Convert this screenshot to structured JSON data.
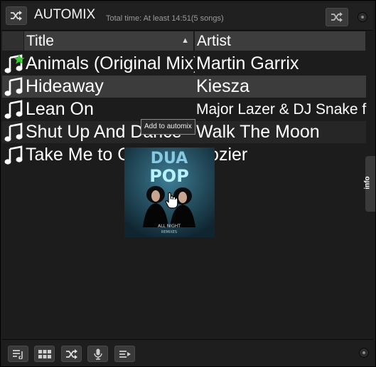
{
  "header": {
    "title": "AUTOMIX",
    "total_time": "Total time: At least 14:51(5 songs)"
  },
  "columns": {
    "title": "Title",
    "artist": "Artist",
    "sort_arrow": "▲"
  },
  "tracks": [
    {
      "title": "Animals (Original Mix)",
      "artist": "Martin Garrix",
      "marker": "green-star"
    },
    {
      "title": "Hideaway",
      "artist": "Kiesza",
      "selected": true
    },
    {
      "title": "Lean On",
      "artist": "Major Lazer & DJ Snake f. I..."
    },
    {
      "title": "Shut Up And Dance",
      "artist": "Walk The Moon"
    },
    {
      "title": "Take Me to Church",
      "artist": "Hozier"
    }
  ],
  "drag": {
    "tooltip": "Add to automix",
    "cover_art": {
      "line1": "DUA",
      "line2": "POP",
      "line3": "ALL NIGHT",
      "line4": "REMIXES"
    }
  },
  "side_tab": {
    "label": "info"
  },
  "colors": {
    "panel_bg": "#1c1c1c",
    "header_bg": "#3d3d3d",
    "selected_row": "#3c3c3c",
    "star": "#33cc33",
    "text": "#ffffff"
  },
  "icons": {
    "header": [
      "shuffle-icon",
      "shuffle-icon"
    ],
    "footer": [
      "playlist-add-icon",
      "grid-view-icon",
      "shuffle-icon",
      "microphone-icon",
      "queue-icon"
    ]
  }
}
